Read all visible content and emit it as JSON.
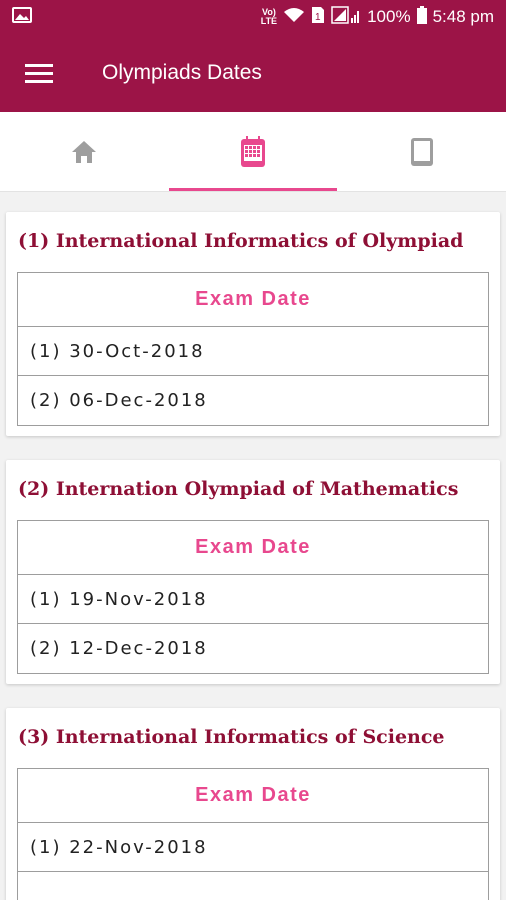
{
  "status_bar": {
    "network_label": "VoLTE",
    "battery": "100%",
    "time": "5:48 pm"
  },
  "app_bar": {
    "title": "Olympiads Dates"
  },
  "tabs": [
    {
      "icon": "home-icon",
      "active": false
    },
    {
      "icon": "calendar-icon",
      "active": true
    },
    {
      "icon": "tablet-icon",
      "active": false
    }
  ],
  "colors": {
    "primary": "#9c1447",
    "accent": "#e8488e",
    "card_title": "#8e0f35"
  },
  "cards": [
    {
      "title": "(1) International Informatics of Olympiad",
      "header": "Exam Date",
      "rows": [
        "(1) 30-Oct-2018",
        "(2) 06-Dec-2018"
      ]
    },
    {
      "title": "(2) Internation Olympiad of Mathematics",
      "header": "Exam Date",
      "rows": [
        "(1) 19-Nov-2018",
        "(2) 12-Dec-2018"
      ]
    },
    {
      "title": "(3) International Informatics of Science",
      "header": "Exam Date",
      "rows": [
        "(1) 22-Nov-2018",
        ""
      ]
    }
  ]
}
